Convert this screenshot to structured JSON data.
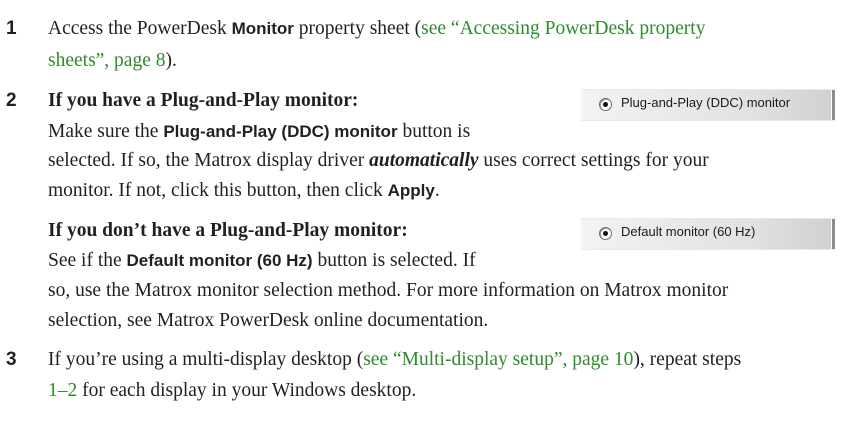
{
  "steps": [
    {
      "number": "1",
      "line1": {
        "t1": "Access the PowerDesk ",
        "b1": "Monitor",
        "t2": " property sheet (",
        "link": "see “Accessing PowerDesk property"
      },
      "line2": {
        "link": "sheets”, page 8",
        "t1": ")."
      }
    },
    {
      "number": "2",
      "pnp": {
        "heading": "If you have a Plug-and-Play monitor:",
        "line1_t1": "Make sure the ",
        "line1_b1": "Plug-and-Play (DDC) monitor",
        "line1_t2": " button is",
        "line2_t1": "selected. If so, the Matrox display driver ",
        "line2_bi": "automatically",
        "line2_t2": " uses correct settings for your",
        "line3_t1": "monitor. If not, click this button, then click ",
        "line3_b1": "Apply",
        "line3_t2": ".",
        "widget_label": "Plug-and-Play (DDC) monitor"
      },
      "default": {
        "heading": "If you don’t have a Plug-and-Play monitor:",
        "line1_t1": "See if the ",
        "line1_b1": "Default monitor (60 Hz)",
        "line1_t2": " button is selected. If",
        "line2": "so, use the Matrox monitor selection method. For more information on Matrox monitor",
        "line3": "selection, see Matrox PowerDesk online documentation.",
        "widget_label": "Default monitor (60 Hz)"
      }
    },
    {
      "number": "3",
      "line1": {
        "t1": "If you’re using a multi-display desktop (",
        "link": "see “Multi-display setup”, page 10",
        "t2": "), repeat steps"
      },
      "line2": {
        "link": "1–2",
        "t1": " for each display in your Windows desktop."
      }
    }
  ],
  "colors": {
    "link": "#2e8b2e",
    "text": "#231f20"
  }
}
